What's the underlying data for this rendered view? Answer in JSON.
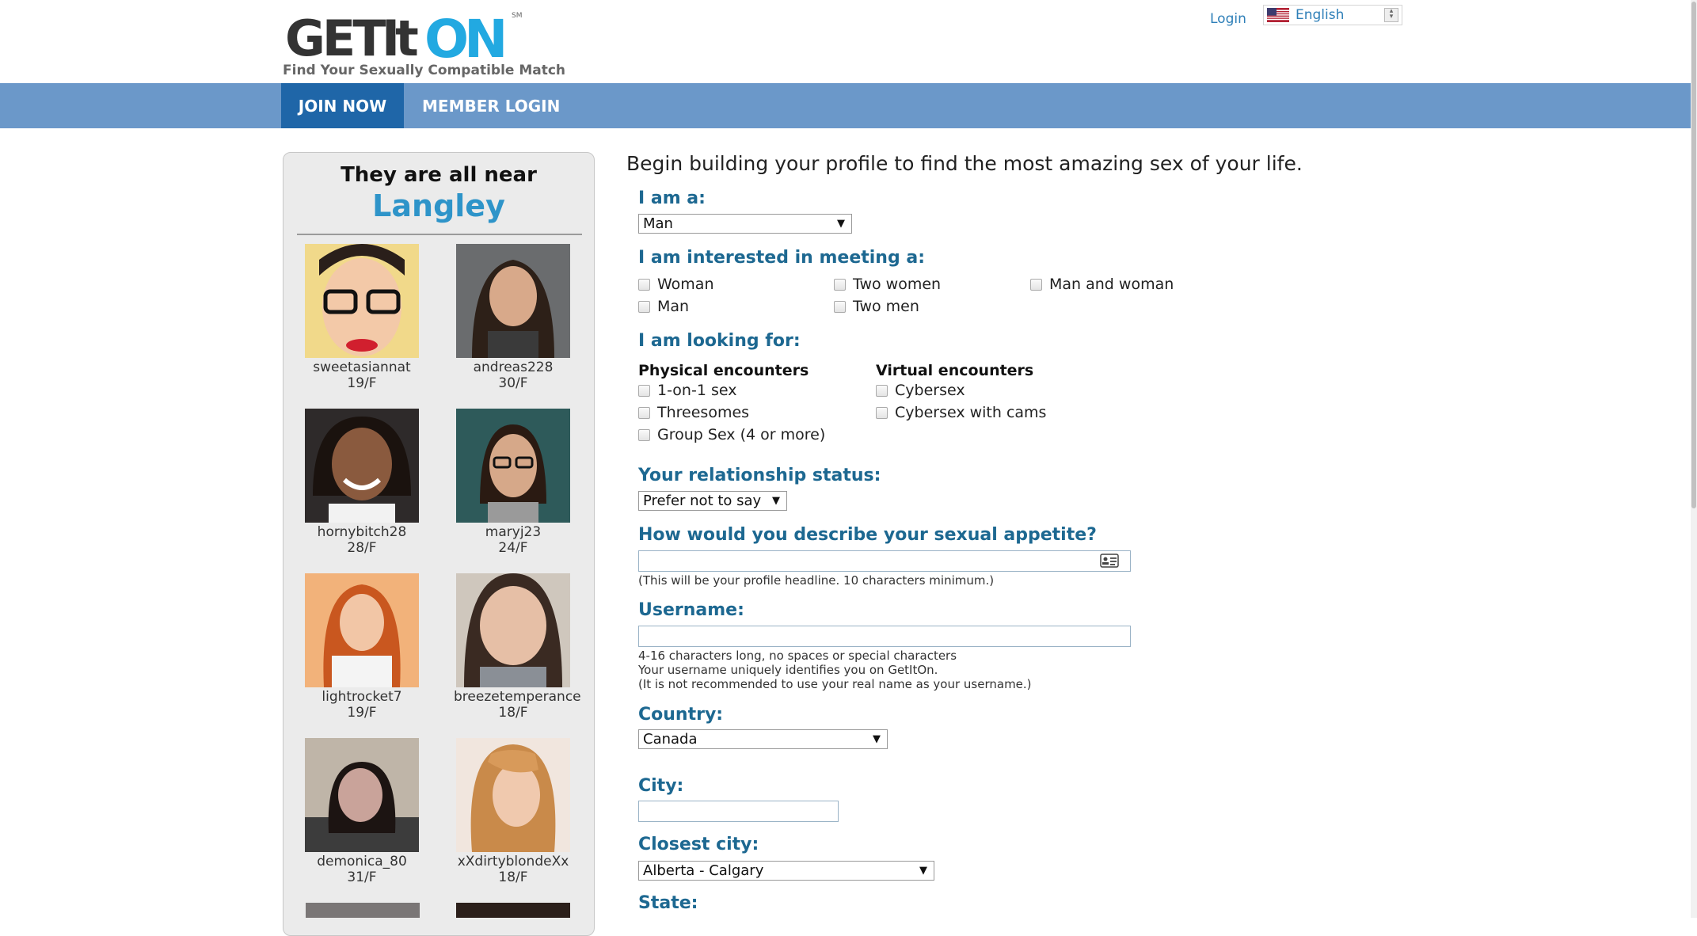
{
  "header": {
    "logo_get": "GET",
    "logo_it": "It",
    "logo_on": "ON",
    "logo_sm": "SM",
    "tagline": "Find Your Sexually Compatible Match",
    "login_label": "Login",
    "language": "English"
  },
  "nav": {
    "join_label": "JOIN NOW",
    "member_login_label": "MEMBER LOGIN"
  },
  "sidebar": {
    "title_line1": "They are all near",
    "title_line2": "Langley",
    "members": [
      {
        "name": "sweetasiannat",
        "age": "19/F"
      },
      {
        "name": "andreas228",
        "age": "30/F"
      },
      {
        "name": "hornybitch28",
        "age": "28/F"
      },
      {
        "name": "maryj23",
        "age": "24/F"
      },
      {
        "name": "lightrocket7",
        "age": "19/F"
      },
      {
        "name": "breezetemperance",
        "age": "18/F"
      },
      {
        "name": "demonica_80",
        "age": "31/F"
      },
      {
        "name": "xXdirtyblondeXx",
        "age": "18/F"
      }
    ]
  },
  "form": {
    "intro": "Begin building your profile to find the most amazing sex of your life.",
    "i_am": {
      "label": "I am a:",
      "value": "Man"
    },
    "interested": {
      "label": "I am interested in meeting a:",
      "options": [
        "Woman",
        "Two women",
        "Man and woman",
        "Man",
        "Two men"
      ]
    },
    "looking_for": {
      "label": "I am looking for:",
      "physical_heading": "Physical encounters",
      "physical": [
        "1-on-1 sex",
        "Threesomes",
        "Group Sex (4 or more)"
      ],
      "virtual_heading": "Virtual encounters",
      "virtual": [
        "Cybersex",
        "Cybersex with cams"
      ]
    },
    "relationship": {
      "label": "Your relationship status:",
      "value": "Prefer not to say"
    },
    "appetite": {
      "label": "How would you describe your sexual appetite?",
      "hint": "(This will be your profile headline. 10 characters minimum.)"
    },
    "username": {
      "label": "Username:",
      "hint1": "4-16 characters long, no spaces or special characters",
      "hint2": "Your username uniquely identifies you on GetItOn.",
      "hint3": "(It is not recommended to use your real name as your username.)"
    },
    "country": {
      "label": "Country:",
      "value": "Canada"
    },
    "city": {
      "label": "City:"
    },
    "closest_city": {
      "label": "Closest city:",
      "value": "Alberta - Calgary"
    },
    "state": {
      "label": "State:"
    }
  },
  "colors": {
    "nav_bar": "#6b98c9",
    "nav_active": "#1f66a8",
    "label_blue": "#1d6891",
    "accent_cyan": "#2e94c9"
  }
}
